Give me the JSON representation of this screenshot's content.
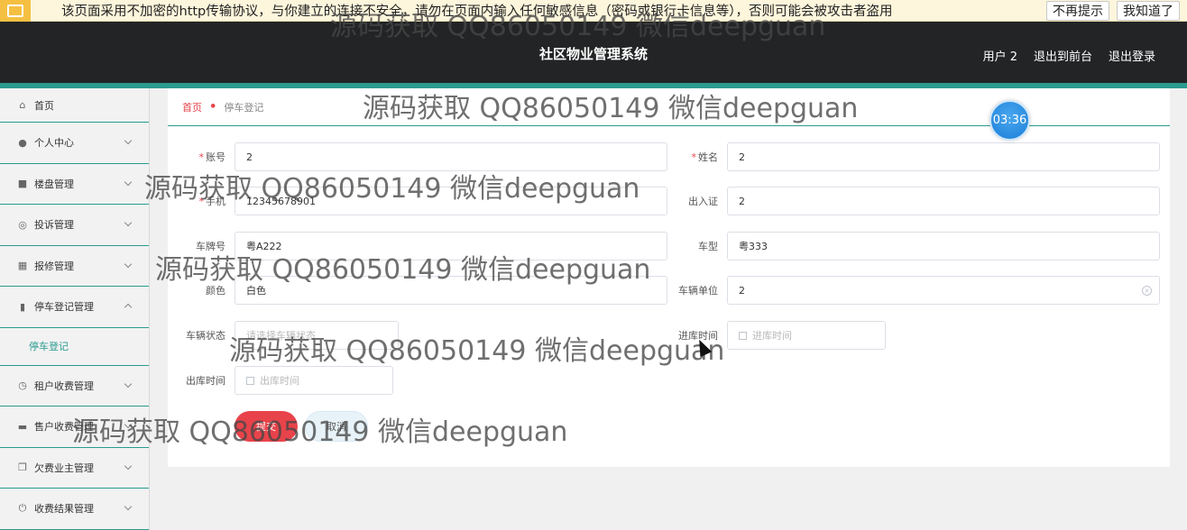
{
  "notice": {
    "text": "该页面采用不加密的http传输协议，与你建立的连接不安全，请勿在页面内输入任何敏感信息（密码或银行卡信息等），否则可能会被攻击者盗用",
    "btn_no_remind": "不再提示",
    "btn_got_it": "我知道了"
  },
  "header": {
    "title": "社区物业管理系统",
    "user": "用户 2",
    "to_front": "退出到前台",
    "logout": "退出登录"
  },
  "sidebar": {
    "items": [
      {
        "label": "首页",
        "icon": "home-icon"
      },
      {
        "label": "个人中心",
        "icon": "user-icon"
      },
      {
        "label": "楼盘管理",
        "icon": "building-icon"
      },
      {
        "label": "投诉管理",
        "icon": "complaint-icon"
      },
      {
        "label": "报修管理",
        "icon": "grid-icon"
      },
      {
        "label": "停车登记管理",
        "icon": "parking-icon"
      },
      {
        "label": "停车登记",
        "icon": ""
      },
      {
        "label": "租户收费管理",
        "icon": "clock-icon"
      },
      {
        "label": "售户收费管理",
        "icon": "card-icon"
      },
      {
        "label": "欠费业主管理",
        "icon": "copy-icon"
      },
      {
        "label": "收费结果管理",
        "icon": "power-icon"
      }
    ]
  },
  "breadcrumb": {
    "home": "首页",
    "current": "停车登记"
  },
  "form": {
    "account_label": "账号",
    "account_value": "2",
    "name_label": "姓名",
    "name_value": "2",
    "phone_label": "手机",
    "phone_value": "12345678901",
    "pass_label": "出入证",
    "pass_value": "2",
    "plate_label": "车牌号",
    "plate_value": "粤A222",
    "model_label": "车型",
    "model_value": "粤333",
    "color_label": "颜色",
    "color_value": "白色",
    "unit_label": "车辆单位",
    "unit_value": "2",
    "status_label": "车辆状态",
    "status_placeholder": "请选择车辆状态",
    "in_time_label": "进库时间",
    "in_time_placeholder": "进库时间",
    "out_time_label": "出库时间",
    "out_time_placeholder": "出库时间",
    "submit": "提交",
    "cancel": "取消"
  },
  "timer": "03:36",
  "watermark": "源码获取 QQ86050149 微信deepguan",
  "colors": {
    "accent": "#2a9b8e",
    "header_bg": "#222425",
    "danger": "#e8434a"
  }
}
